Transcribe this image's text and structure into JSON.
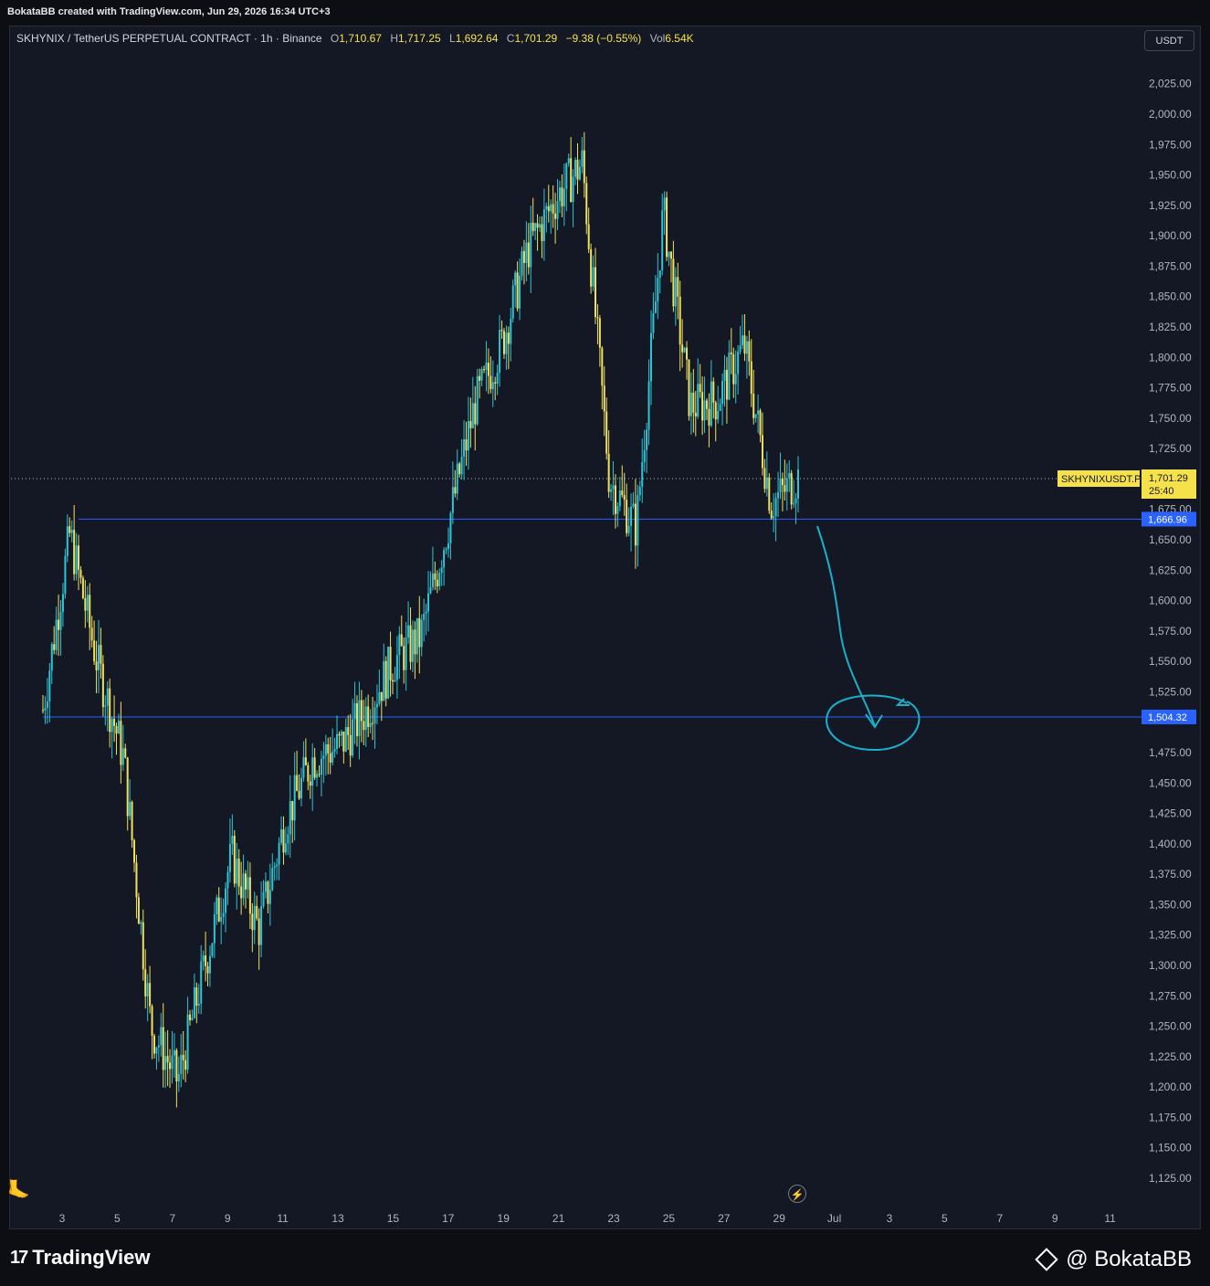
{
  "header": {
    "credit": "BokataBB created with TradingView.com, Jun 29, 2026 16:34 UTC+3"
  },
  "legend": {
    "symbol": "SKHYNIX / TetherUS PERPETUAL CONTRACT · 1h · Binance",
    "o_label": "O",
    "o": "1,710.67",
    "h_label": "H",
    "h": "1,717.25",
    "l_label": "L",
    "l": "1,692.64",
    "c_label": "C",
    "c": "1,701.29",
    "change": "−9.38 (−0.55%)",
    "vol_label": "Vol",
    "vol": "6.54K"
  },
  "currency_button": "USDT",
  "footer": {
    "brand": "TradingView",
    "author": "@ BokataBB"
  },
  "icons": {
    "bolt": "lightning-icon",
    "tool": "cursor-tool-icon",
    "logo": "tradingview-logo-icon",
    "exchange": "binance-diamond-icon"
  },
  "colors": {
    "background": "#141824",
    "candle_up": "#2ec4d6",
    "candle_down": "#f0e060",
    "level_line": "#2962ff",
    "price_label": "#f5e14a",
    "drawing": "#1ab0cc"
  },
  "chart_data": {
    "type": "candlestick",
    "symbol_tag": "SKHYNIXUSDT.P",
    "last_price": "1,701.29",
    "countdown": "25:40",
    "y_ticks": [
      "2,025.00",
      "2,000.00",
      "1,975.00",
      "1,950.00",
      "1,925.00",
      "1,900.00",
      "1,875.00",
      "1,850.00",
      "1,825.00",
      "1,800.00",
      "1,775.00",
      "1,750.00",
      "1,725.00",
      "1,675.00",
      "1,650.00",
      "1,625.00",
      "1,600.00",
      "1,575.00",
      "1,550.00",
      "1,525.00",
      "1,475.00",
      "1,450.00",
      "1,425.00",
      "1,400.00",
      "1,375.00",
      "1,350.00",
      "1,325.00",
      "1,300.00",
      "1,275.00",
      "1,250.00",
      "1,225.00",
      "1,200.00",
      "1,175.00",
      "1,150.00",
      "1,125.00"
    ],
    "x_ticks": [
      "3",
      "5",
      "7",
      "9",
      "11",
      "13",
      "15",
      "17",
      "19",
      "21",
      "23",
      "25",
      "27",
      "29",
      "Jul",
      "3",
      "5",
      "7",
      "9",
      "11"
    ],
    "ylim": [
      1115,
      2045
    ],
    "levels": [
      {
        "price": 1666.96,
        "label": "1,666.96"
      },
      {
        "price": 1504.32,
        "label": "1,504.32"
      }
    ],
    "series": [
      {
        "date": "Jun 2",
        "value": 1510
      },
      {
        "date": "Jun 3",
        "value": 1655
      },
      {
        "date": "Jun 4",
        "value": 1550
      },
      {
        "date": "Jun 5",
        "value": 1470
      },
      {
        "date": "Jun 6",
        "value": 1250
      },
      {
        "date": "Jun 7",
        "value": 1205
      },
      {
        "date": "Jun 8",
        "value": 1300
      },
      {
        "date": "Jun 9",
        "value": 1390
      },
      {
        "date": "Jun 10",
        "value": 1330
      },
      {
        "date": "Jun 11",
        "value": 1420
      },
      {
        "date": "Jun 12",
        "value": 1470
      },
      {
        "date": "Jun 13",
        "value": 1480
      },
      {
        "date": "Jun 14",
        "value": 1510
      },
      {
        "date": "Jun 15",
        "value": 1550
      },
      {
        "date": "Jun 16",
        "value": 1570
      },
      {
        "date": "Jun 17",
        "value": 1660
      },
      {
        "date": "Jun 18",
        "value": 1760
      },
      {
        "date": "Jun 19",
        "value": 1810
      },
      {
        "date": "Jun 20",
        "value": 1890
      },
      {
        "date": "Jun 21",
        "value": 1930
      },
      {
        "date": "Jun 22",
        "value": 1960
      },
      {
        "date": "Jun 23",
        "value": 1700
      },
      {
        "date": "Jun 24",
        "value": 1660
      },
      {
        "date": "Jun 25",
        "value": 1920
      },
      {
        "date": "Jun 26",
        "value": 1760
      },
      {
        "date": "Jun 27",
        "value": 1765
      },
      {
        "date": "Jun 28",
        "value": 1810
      },
      {
        "date": "Jun 29",
        "value": 1680
      },
      {
        "date": "Jun 29 16:00",
        "value": 1701.29
      }
    ]
  }
}
